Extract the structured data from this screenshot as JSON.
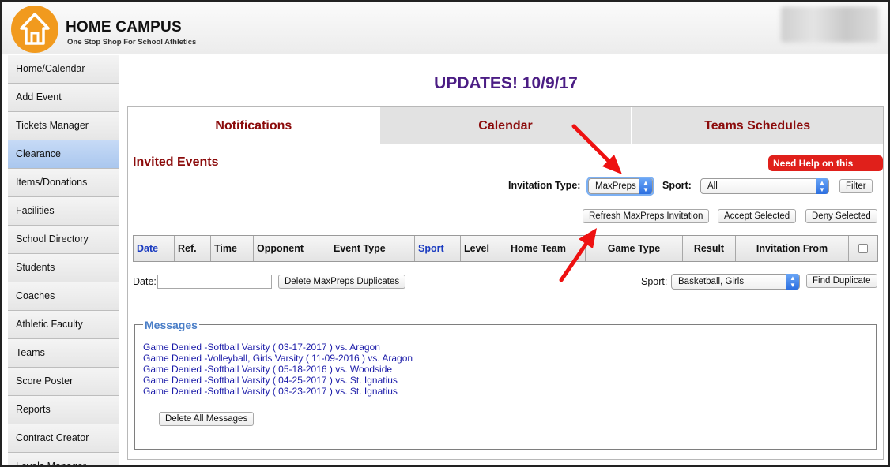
{
  "header": {
    "brand_title": "HOME CAMPUS",
    "brand_subtitle": "One Stop Shop For School Athletics",
    "logo_color": "#f19a1e"
  },
  "sidebar": {
    "items": [
      {
        "label": "Home/Calendar"
      },
      {
        "label": "Add Event"
      },
      {
        "label": "Tickets Manager"
      },
      {
        "label": "Clearance",
        "active": true
      },
      {
        "label": "Items/Donations"
      },
      {
        "label": "Facilities"
      },
      {
        "label": "School Directory"
      },
      {
        "label": "Students"
      },
      {
        "label": "Coaches"
      },
      {
        "label": "Athletic Faculty"
      },
      {
        "label": "Teams"
      },
      {
        "label": "Score Poster"
      },
      {
        "label": "Reports"
      },
      {
        "label": "Contract Creator"
      },
      {
        "label": "Levels Manager"
      }
    ]
  },
  "page": {
    "title": "UPDATES! 10/9/17",
    "title_color": "#4b1d84"
  },
  "tabs": [
    {
      "label": "Notifications",
      "active": true
    },
    {
      "label": "Calendar"
    },
    {
      "label": "Teams Schedules"
    }
  ],
  "section": {
    "title": "Invited Events",
    "help_label": "Need Help on this Page?"
  },
  "filters": {
    "invitation_type_label": "Invitation Type:",
    "invitation_type_value": "MaxPreps",
    "sport_label": "Sport:",
    "sport_value": "All",
    "filter_button": "Filter"
  },
  "actions": {
    "refresh": "Refresh MaxPreps Invitation",
    "accept": "Accept Selected",
    "deny": "Deny Selected"
  },
  "table": {
    "columns": [
      "Date",
      "Ref.",
      "Time",
      "Opponent",
      "Event Type",
      "Sport",
      "Level",
      "Home Team",
      "Game Type",
      "Result",
      "Invitation From"
    ]
  },
  "duplicates": {
    "date_label": "Date:",
    "date_value": "",
    "delete_button": "Delete MaxPreps Duplicates",
    "sport_label": "Sport:",
    "sport_value": "Basketball, Girls",
    "find_button": "Find Duplicate"
  },
  "messages": {
    "legend": "Messages",
    "items": [
      "Game Denied -Softball Varsity ( 03-17-2017 ) vs. Aragon",
      "Game Denied -Volleyball, Girls Varsity ( 11-09-2016 ) vs. Aragon",
      "Game Denied -Softball Varsity ( 05-18-2016 ) vs. Woodside",
      "Game Denied -Softball Varsity ( 04-25-2017 ) vs. St. Ignatius",
      "Game Denied -Softball Varsity ( 03-23-2017 ) vs. St. Ignatius"
    ],
    "delete_all": "Delete All Messages"
  },
  "colors": {
    "accent_red": "#8b0b0b",
    "help_red": "#e0201b",
    "link_blue": "#1a1aa8",
    "annotation_red": "#ee1111"
  }
}
